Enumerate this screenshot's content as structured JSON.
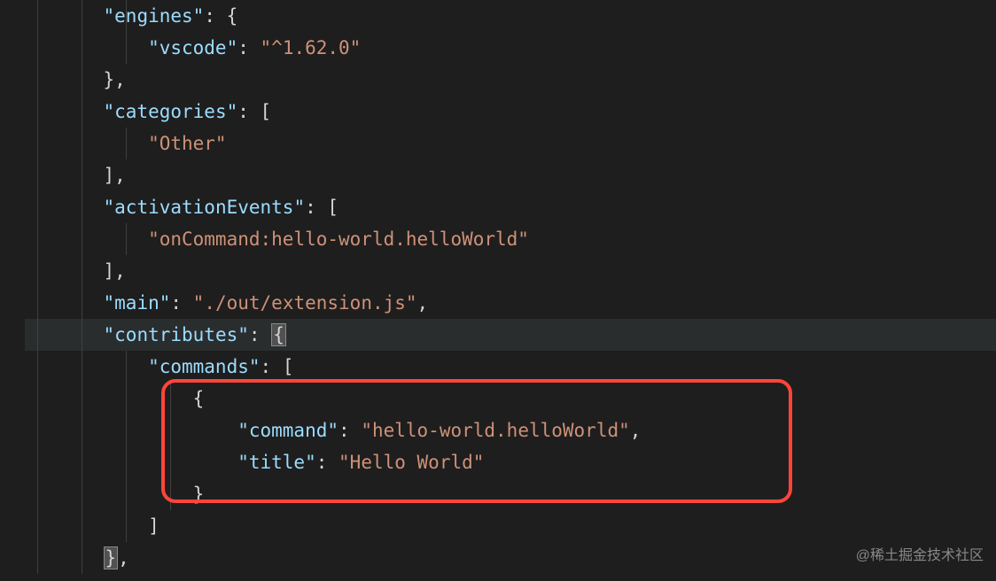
{
  "gutter": [
    "",
    "",
    "",
    "",
    "",
    "",
    "",
    "",
    "",
    "",
    "",
    "",
    "",
    "",
    "",
    "",
    "",
    ""
  ],
  "code": {
    "engines_key": "\"engines\"",
    "vscode_key": "\"vscode\"",
    "vscode_val": "\"^1.62.0\"",
    "categories_key": "\"categories\"",
    "other_val": "\"Other\"",
    "activationEvents_key": "\"activationEvents\"",
    "activation_val": "\"onCommand:hello-world.helloWorld\"",
    "main_key": "\"main\"",
    "main_val": "\"./out/extension.js\"",
    "contributes_key": "\"contributes\"",
    "commands_key": "\"commands\"",
    "command_key": "\"command\"",
    "command_val": "\"hello-world.helloWorld\"",
    "title_key": "\"title\"",
    "title_val": "\"Hello World\""
  },
  "watermark": "@稀土掘金技术社区"
}
